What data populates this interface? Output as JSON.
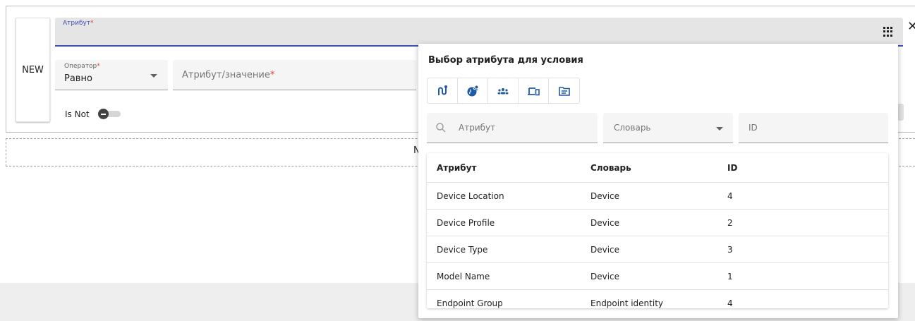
{
  "condition": {
    "new_label": "NEW",
    "attribute_label": "Атрибут",
    "required_mark": "*",
    "operator_label": "Оператор",
    "operator_value": "Равно",
    "value_label": "Атрибут/значение",
    "isnot_label": "Is Not",
    "isnot_checked": false,
    "close_glyph": "✕",
    "dashed_text": "N"
  },
  "popup": {
    "title": "Выбор атрибута для условия",
    "icon_tabs": [
      {
        "name": "flow-icon"
      },
      {
        "name": "globe-person-icon"
      },
      {
        "name": "group-icon"
      },
      {
        "name": "devices-icon"
      },
      {
        "name": "list-box-icon"
      }
    ],
    "search_placeholder": "Атрибут",
    "dictionary_placeholder": "Словарь",
    "id_placeholder": "ID",
    "columns": [
      "Атрибут",
      "Словарь",
      "ID"
    ],
    "rows": [
      {
        "attribute": "Device Location",
        "dictionary": "Device",
        "id": "4"
      },
      {
        "attribute": "Device Profile",
        "dictionary": "Device",
        "id": "2"
      },
      {
        "attribute": "Device Type",
        "dictionary": "Device",
        "id": "3"
      },
      {
        "attribute": "Model Name",
        "dictionary": "Device",
        "id": "1"
      },
      {
        "attribute": "Endpoint Group",
        "dictionary": "Endpoint identity",
        "id": "4"
      }
    ]
  },
  "colors": {
    "accent": "#3f51b5",
    "required": "#e53935",
    "icon_blue": "#1e5aa8"
  }
}
